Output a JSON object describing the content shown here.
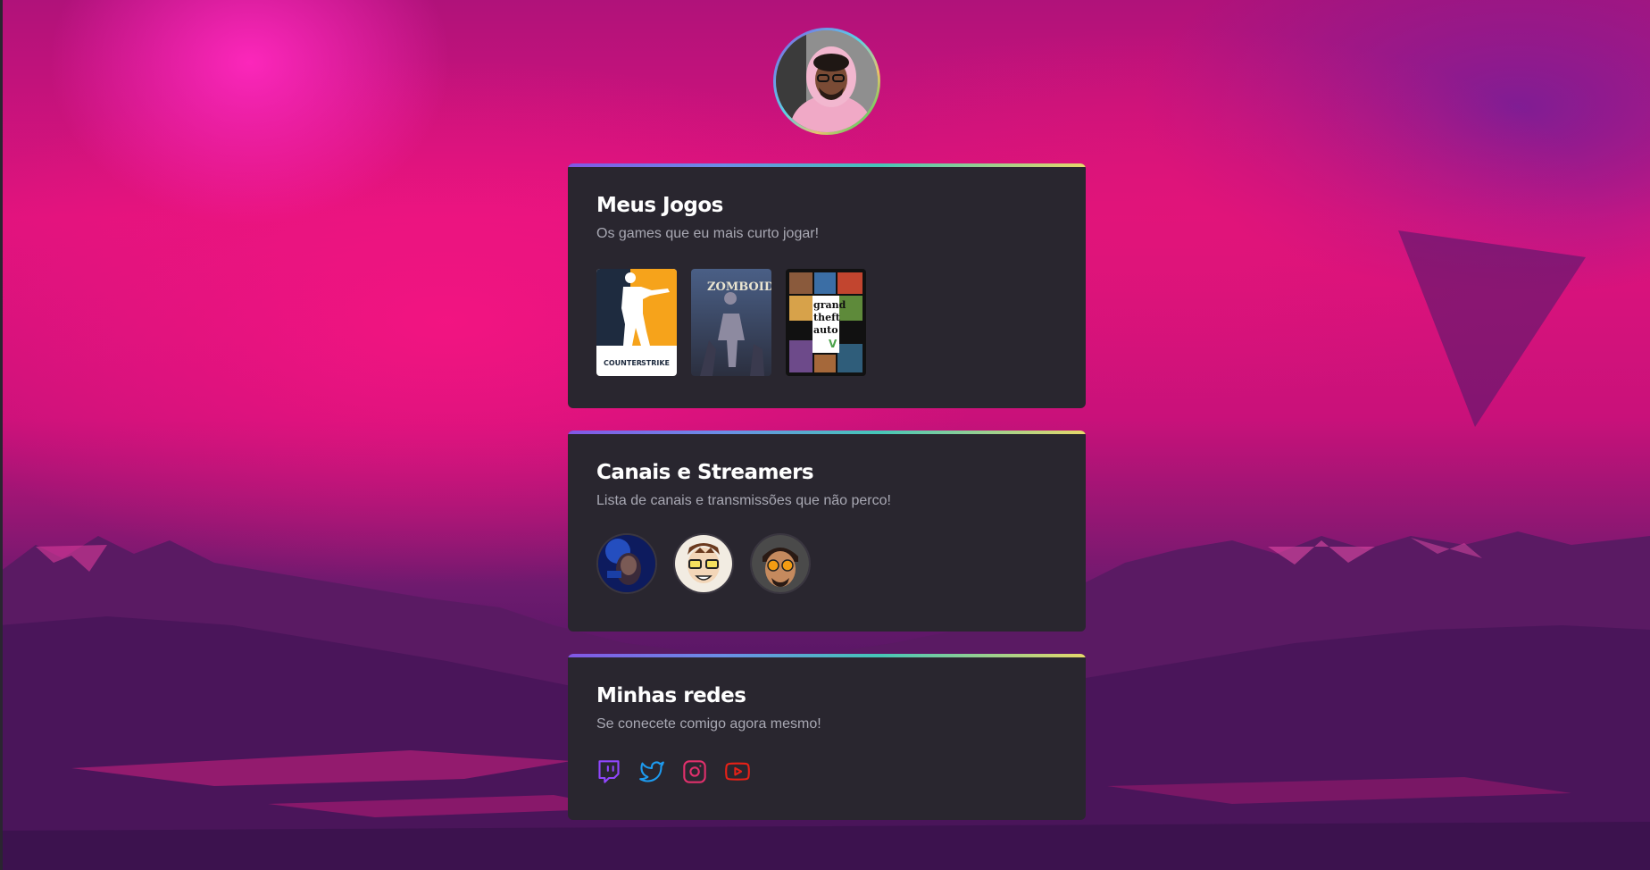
{
  "profile": {
    "avatar_icon": "profile-photo"
  },
  "games_section": {
    "title": "Meus Jogos",
    "subtitle": "Os games que eu mais curto jogar!",
    "games": [
      {
        "icon": "counter-strike-cover",
        "logo_text": "COUNTER STRIKE",
        "accent": "#f6a31b"
      },
      {
        "icon": "project-zomboid-cover",
        "logo_text": "ZOMBOID",
        "accent": "#3a4e72"
      },
      {
        "icon": "gta-v-cover",
        "logo_text": "grand theft auto",
        "accent": "#2b2b2b"
      }
    ]
  },
  "streamers_section": {
    "title": "Canais e Streamers",
    "subtitle": "Lista de canais e transmissões que não perco!",
    "streamers": [
      {
        "icon": "streamer-avatar-1"
      },
      {
        "icon": "streamer-avatar-2"
      },
      {
        "icon": "streamer-avatar-3"
      }
    ]
  },
  "social_section": {
    "title": "Minhas redes",
    "subtitle": "Se conecete comigo agora mesmo!",
    "links": [
      {
        "icon": "twitch-icon",
        "color": "#9146ff"
      },
      {
        "icon": "twitter-icon",
        "color": "#1d9bf0"
      },
      {
        "icon": "instagram-icon",
        "color": "#e1306c"
      },
      {
        "icon": "youtube-icon",
        "color": "#e62117"
      }
    ]
  },
  "colors": {
    "card_background": "#29262f",
    "title_text": "#ffffff",
    "subtitle_text": "#a8a8b3",
    "top_border_gradient": [
      "#8257e5",
      "#45c6b8",
      "#e6d86a"
    ]
  }
}
